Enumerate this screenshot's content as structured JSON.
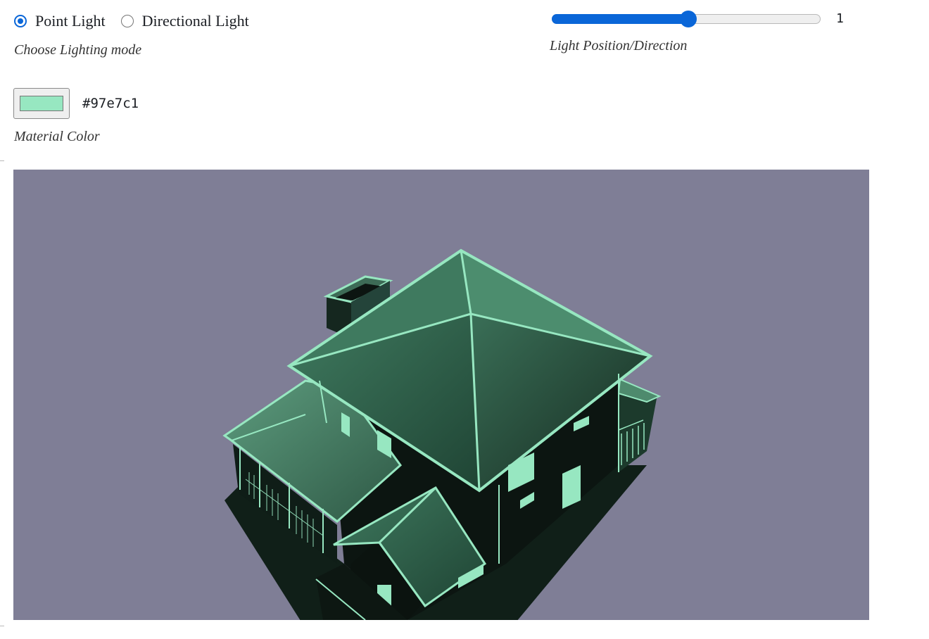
{
  "lighting": {
    "options": [
      {
        "label": "Point Light",
        "checked": true
      },
      {
        "label": "Directional Light",
        "checked": false
      }
    ],
    "caption": "Choose Lighting mode"
  },
  "light_slider": {
    "value": "1",
    "fraction": 0.505,
    "caption": "Light Position/Direction"
  },
  "material": {
    "hex": "#97e7c1",
    "caption": "Material Color"
  },
  "scene": {
    "background": "#7f7e96",
    "model": "house-model"
  },
  "colors": {
    "accent": "#0a66d8",
    "material": "#97e7c1"
  }
}
